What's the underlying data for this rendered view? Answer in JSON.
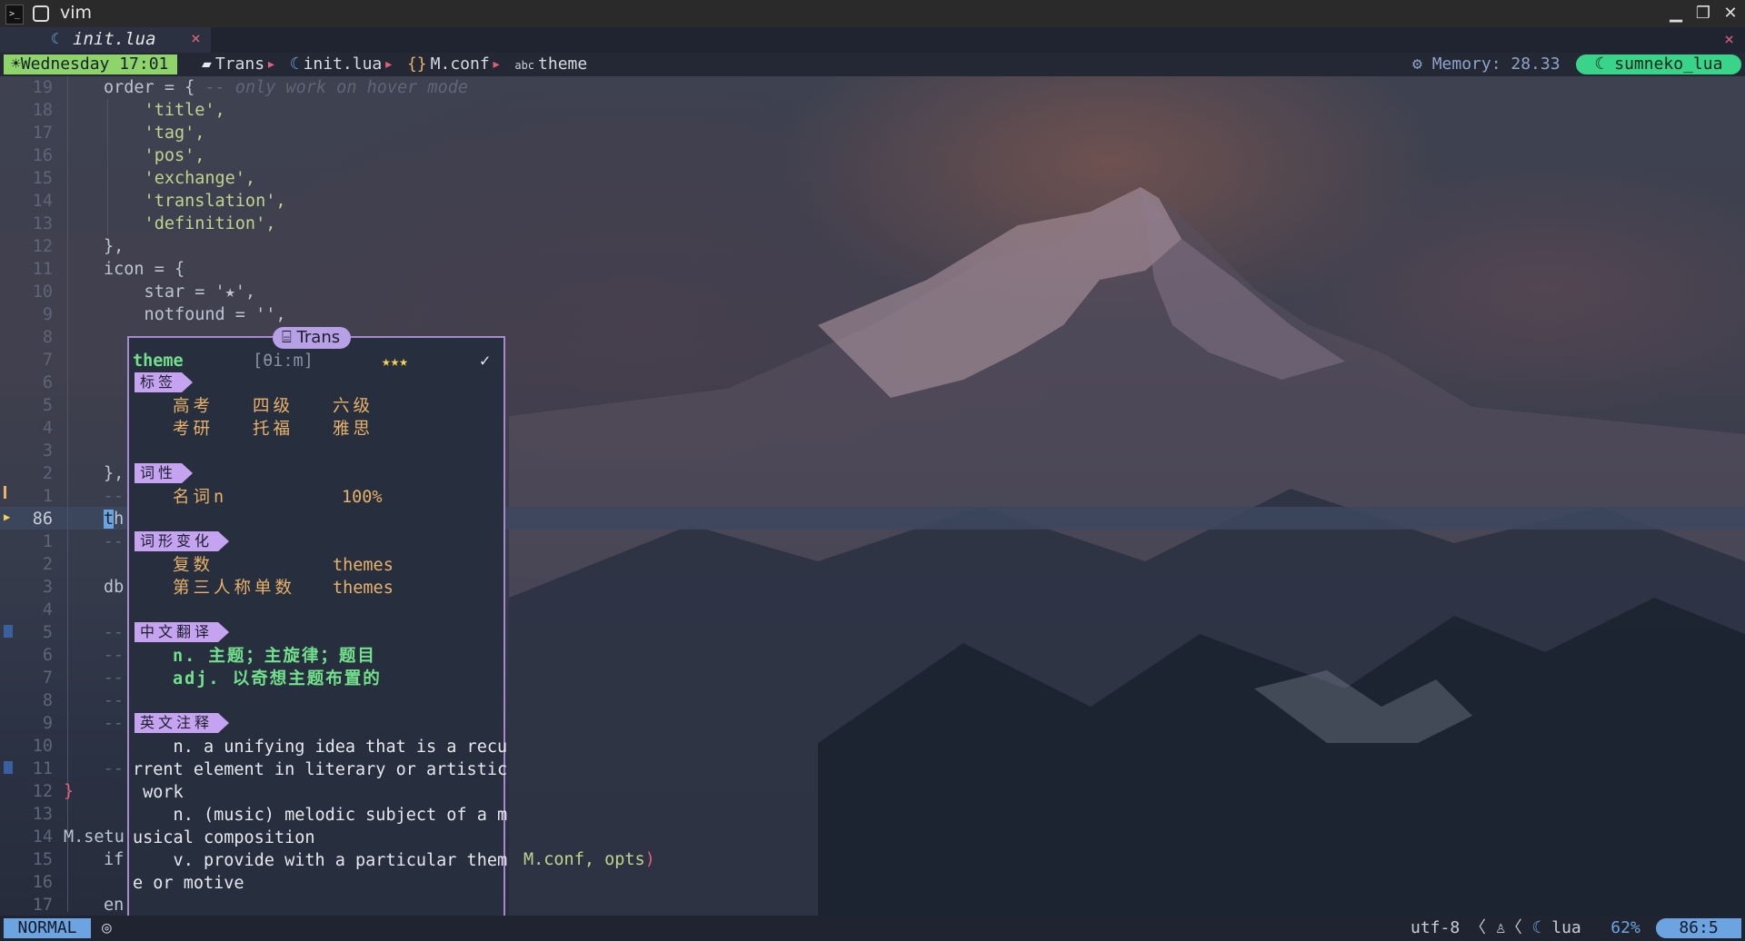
{
  "window": {
    "title": "vim"
  },
  "tab": {
    "name": "init.lua",
    "close": "×",
    "close_all": "×"
  },
  "winbar": {
    "date": "Wednesday 17:01",
    "crumbs": [
      "Trans",
      "init.lua",
      "M.conf",
      "theme"
    ],
    "memory": "Memory: 28.33",
    "lsp": "sumneko_lua"
  },
  "editor": {
    "lines": [
      {
        "num": "19",
        "code": "order = { ",
        "comment": "-- only work on hover mode"
      },
      {
        "num": "18",
        "code": "    'title',",
        "str": true
      },
      {
        "num": "17",
        "code": "    'tag',",
        "str": true
      },
      {
        "num": "16",
        "code": "    'pos',",
        "str": true
      },
      {
        "num": "15",
        "code": "    'exchange',",
        "str": true
      },
      {
        "num": "14",
        "code": "    'translation',",
        "str": true
      },
      {
        "num": "13",
        "code": "    'definition',",
        "str": true
      },
      {
        "num": "12",
        "code": "},",
        "comment": ""
      },
      {
        "num": "11",
        "code": "icon = {",
        "comment": ""
      },
      {
        "num": "10",
        "code": "    star = '★',",
        "comment": ""
      },
      {
        "num": "9",
        "code": "    notfound = '',",
        "comment": ""
      },
      {
        "num": "8",
        "code": "",
        "comment": ""
      },
      {
        "num": "7",
        "code": "",
        "comment": ""
      },
      {
        "num": "6",
        "code": "",
        "comment": ""
      },
      {
        "num": "5",
        "code": "",
        "comment": ""
      },
      {
        "num": "4",
        "code": "",
        "comment": ""
      },
      {
        "num": "3",
        "code": "",
        "comment": ""
      },
      {
        "num": "2",
        "code": "},",
        "comment": ""
      },
      {
        "num": "1",
        "code": "--",
        "comment": ""
      },
      {
        "num": "86",
        "code": "th",
        "comment": ""
      },
      {
        "num": "1",
        "code": "--",
        "comment": ""
      },
      {
        "num": "2",
        "code": "",
        "comment": ""
      },
      {
        "num": "3",
        "code": "db",
        "comment": ""
      },
      {
        "num": "4",
        "code": "",
        "comment": ""
      },
      {
        "num": "5",
        "code": "--",
        "comment": ""
      },
      {
        "num": "6",
        "code": "--",
        "comment": ""
      },
      {
        "num": "7",
        "code": "--",
        "comment": ""
      },
      {
        "num": "8",
        "code": "--",
        "comment": ""
      },
      {
        "num": "9",
        "code": "--",
        "comment": ""
      },
      {
        "num": "10",
        "code": "",
        "comment": ""
      },
      {
        "num": "11",
        "code": "--",
        "comment": ""
      },
      {
        "num": "12",
        "code": "}",
        "comment": ""
      },
      {
        "num": "13",
        "code": "",
        "comment": ""
      },
      {
        "num": "14",
        "code": "M.setu",
        "comment": ""
      },
      {
        "num": "15",
        "code": "if",
        "comment": ""
      },
      {
        "num": "16",
        "code": "",
        "comment": ""
      },
      {
        "num": "17",
        "code": "en",
        "comment": ""
      }
    ],
    "tail_text": "M.conf, opts",
    "tail_paren": ")"
  },
  "popup": {
    "title": "Trans",
    "word": "theme",
    "phonetic": "[θiːm]",
    "stars": "★★★",
    "check": "✓",
    "sections": {
      "tag": "标签",
      "pos": "词性",
      "exchange": "词形变化",
      "translation": "中文翻译",
      "definition": "英文注释"
    },
    "tags": [
      "高考",
      "四级",
      "六级",
      "考研",
      "托福",
      "雅思"
    ],
    "pos_items": [
      {
        "label": "名词n",
        "value": "100%"
      }
    ],
    "exchange_items": [
      {
        "label": "复数",
        "value": "themes"
      },
      {
        "label": "第三人称单数",
        "value": "themes"
      }
    ],
    "translation_items": [
      "n. 主题；主旋律；题目",
      "adj. 以奇想主题布置的"
    ],
    "definition_lines": [
      "    n. a unifying idea that is a recu",
      "rrent element in literary or artistic",
      " work",
      "    n. (music) melodic subject of a m",
      "usical composition",
      "    v. provide with a particular them",
      "e or motive"
    ]
  },
  "statusline": {
    "mode": "NORMAL",
    "encoding": "utf-8",
    "filetype": "lua",
    "percent": "62%",
    "position": "86:5"
  }
}
